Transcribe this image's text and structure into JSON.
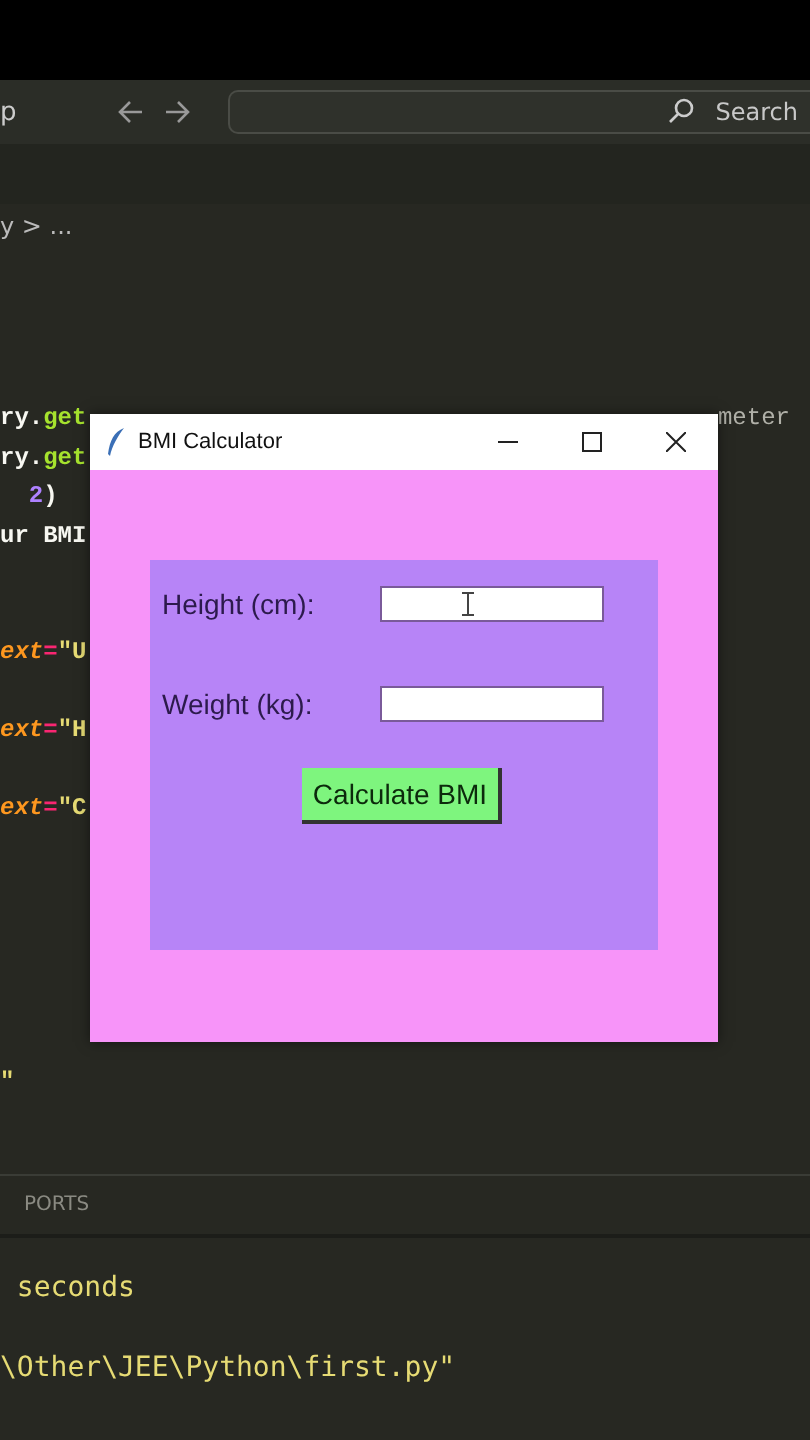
{
  "titlebar": {
    "menu_fragment": "p",
    "search": {
      "placeholder": "Search"
    }
  },
  "breadcrumb": "y > ...",
  "editor": {
    "lines": [
      {
        "kind": "code",
        "tokens": [
          {
            "text": "ry.",
            "kind": "plain"
          },
          {
            "text": "get",
            "kind": "function"
          }
        ],
        "right": "meter"
      },
      {
        "kind": "code",
        "tokens": [
          {
            "text": "ry.",
            "kind": "plain"
          },
          {
            "text": "get",
            "kind": "function"
          }
        ]
      },
      {
        "kind": "code",
        "tokens": [
          {
            "text": "  2",
            "kind": "number"
          },
          {
            "text": ")",
            "kind": "plain"
          }
        ]
      },
      {
        "kind": "code",
        "tokens": [
          {
            "text": "ur BMI",
            "kind": "plain"
          }
        ]
      },
      {
        "kind": "blank"
      },
      {
        "kind": "blank"
      },
      {
        "kind": "code",
        "tokens": [
          {
            "text": "ext",
            "kind": "param"
          },
          {
            "text": "=",
            "kind": "operator"
          },
          {
            "text": "\"U",
            "kind": "string"
          }
        ]
      },
      {
        "kind": "blank"
      },
      {
        "kind": "code",
        "tokens": [
          {
            "text": "ext",
            "kind": "param"
          },
          {
            "text": "=",
            "kind": "operator"
          },
          {
            "text": "\"H",
            "kind": "string"
          }
        ]
      },
      {
        "kind": "blank"
      },
      {
        "kind": "code",
        "tokens": [
          {
            "text": "ext",
            "kind": "param"
          },
          {
            "text": "=",
            "kind": "operator"
          },
          {
            "text": "\"C",
            "kind": "string"
          }
        ]
      },
      {
        "kind": "blank"
      },
      {
        "kind": "blank"
      },
      {
        "kind": "blank"
      },
      {
        "kind": "blank"
      },
      {
        "kind": "blank"
      },
      {
        "kind": "blank"
      },
      {
        "kind": "code",
        "tokens": [
          {
            "text": "\"",
            "kind": "string"
          }
        ]
      }
    ]
  },
  "panel": {
    "tab": "PORTS",
    "terminal_lines": [
      {
        "kind": "text",
        "text": " seconds"
      },
      {
        "kind": "blank"
      },
      {
        "kind": "text",
        "text": "\\Other\\JEE\\Python\\first.py\""
      }
    ]
  },
  "app_window": {
    "title": "BMI Calculator",
    "fields": [
      {
        "label": "Height (cm):"
      },
      {
        "label": "Weight (kg):"
      }
    ],
    "button": "Calculate BMI"
  }
}
